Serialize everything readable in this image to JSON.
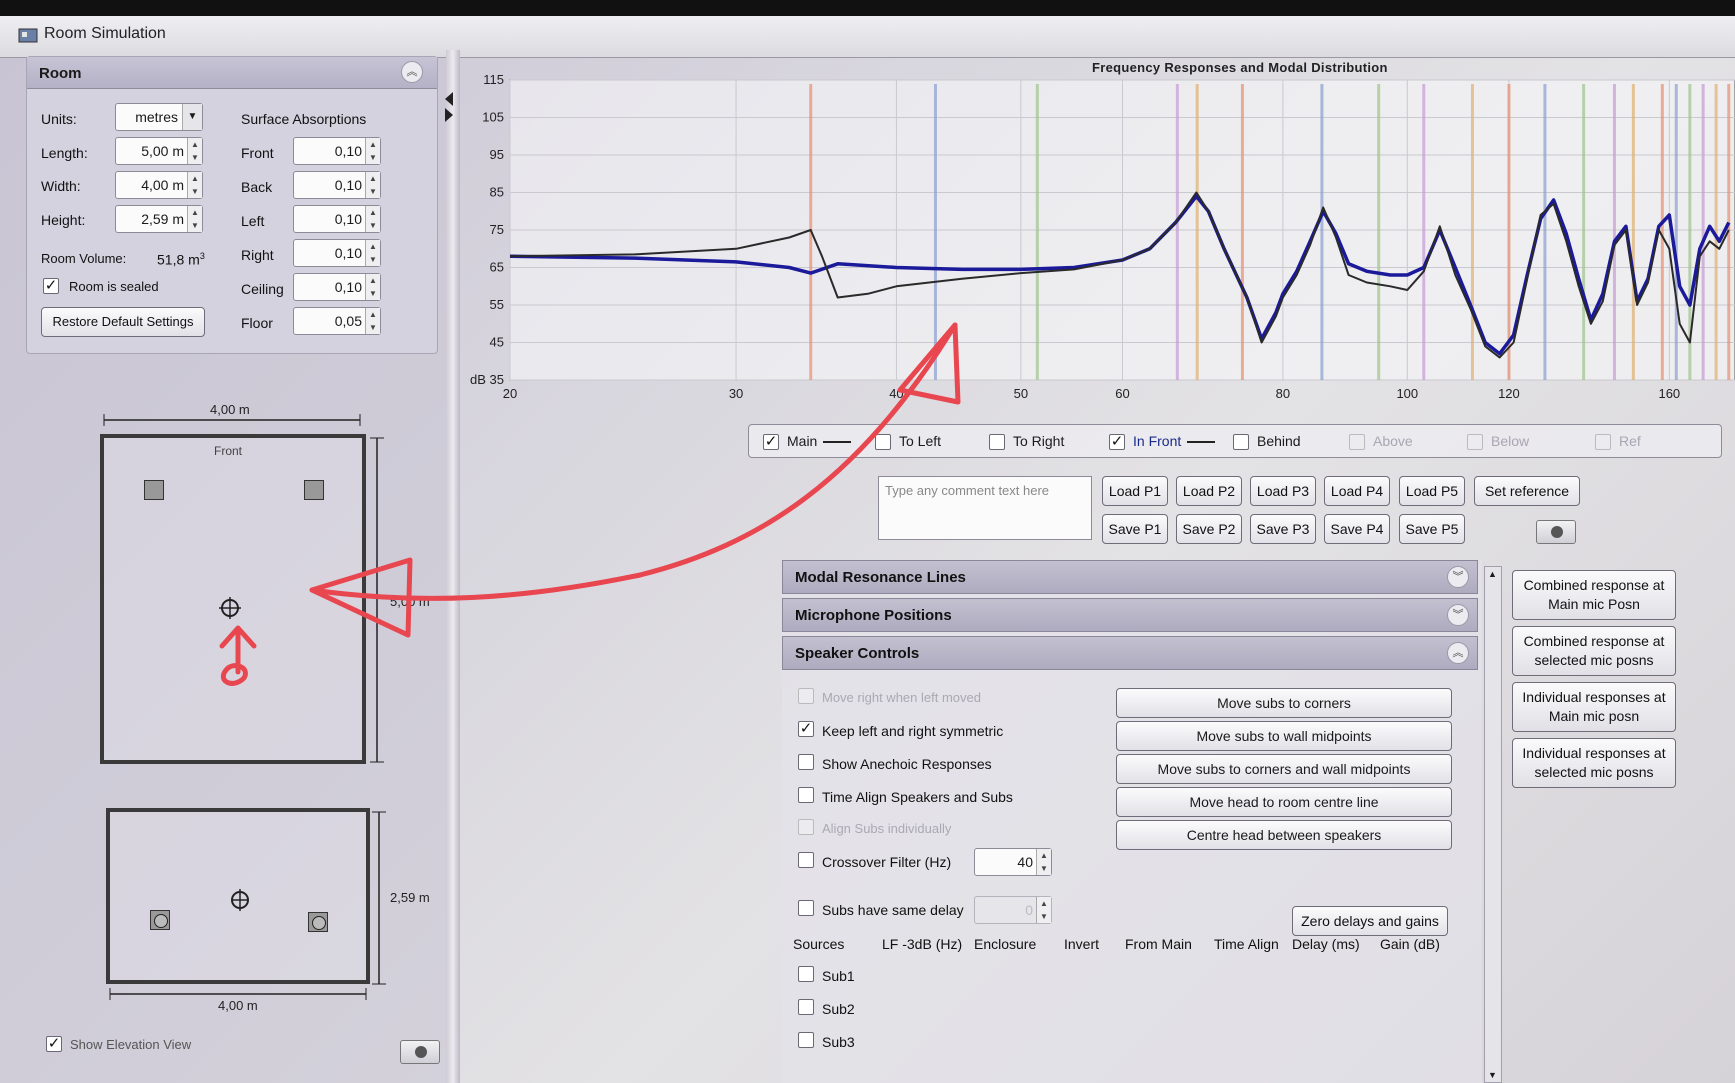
{
  "window": {
    "title": "Room Simulation"
  },
  "room_panel": {
    "title": "Room",
    "units_label": "Units:",
    "units_value": "metres",
    "length_label": "Length:",
    "length_value": "5,00 m",
    "width_label": "Width:",
    "width_value": "4,00 m",
    "height_label": "Height:",
    "height_value": "2,59 m",
    "volume_label": "Room Volume:",
    "volume_value": "51,8 m",
    "volume_unit_sup": "3",
    "sealed_label": "Room is sealed",
    "sealed_checked": true,
    "restore_button": "Restore Default Settings",
    "absorption_title": "Surface Absorptions",
    "surfaces": [
      {
        "label": "Front",
        "value": "0,10"
      },
      {
        "label": "Back",
        "value": "0,10"
      },
      {
        "label": "Left",
        "value": "0,10"
      },
      {
        "label": "Right",
        "value": "0,10"
      },
      {
        "label": "Ceiling",
        "value": "0,10"
      },
      {
        "label": "Floor",
        "value": "0,05"
      }
    ]
  },
  "plan_view": {
    "width_dim": "4,00 m",
    "front_label": "Front",
    "length_dim": "5,00 m"
  },
  "elevation_view": {
    "height_dim": "2,59 m",
    "width_dim": "4,00 m",
    "show_label": "Show Elevation View",
    "show_checked": true
  },
  "chart_data": {
    "type": "line",
    "title": "Frequency Responses and Modal Distribution",
    "ylabel": "dB",
    "ylim": [
      35,
      115
    ],
    "yticks": [
      35,
      45,
      55,
      65,
      75,
      85,
      95,
      105,
      115
    ],
    "xscale": "log",
    "xlim": [
      20,
      180
    ],
    "xticks": [
      20,
      30,
      40,
      50,
      60,
      80,
      100,
      120,
      160
    ],
    "grid": true,
    "series": [
      {
        "name": "Main",
        "color": "#1a1a9a",
        "x": [
          20,
          25,
          30,
          33,
          34.3,
          36,
          40,
          45,
          50,
          55,
          60,
          63,
          66,
          68.5,
          70,
          72,
          75,
          77,
          79,
          80,
          82,
          84,
          86,
          88,
          90,
          93,
          97,
          100,
          103,
          106,
          109,
          112,
          115,
          118,
          121,
          124,
          127,
          130,
          133,
          136,
          139,
          142,
          145,
          148,
          151,
          154,
          157,
          160,
          163,
          166,
          169,
          172,
          175,
          178
        ],
        "y": [
          68,
          67.5,
          66.5,
          65,
          63.5,
          66,
          65,
          64.5,
          64.5,
          65,
          67,
          70,
          77,
          84,
          80,
          70,
          57,
          46,
          53,
          58,
          64,
          72,
          80,
          74,
          66,
          64,
          63,
          63,
          65,
          75,
          65,
          55,
          45,
          42,
          47,
          63,
          78,
          83,
          74,
          62,
          51,
          58,
          72,
          76,
          56,
          62,
          76,
          79,
          60,
          55,
          70,
          76,
          72,
          77
        ]
      },
      {
        "name": "In Front",
        "color": "#2a2a2a",
        "x": [
          20,
          25,
          30,
          33,
          34.3,
          35,
          36,
          38,
          40,
          45,
          50,
          55,
          60,
          63,
          66,
          68.5,
          70,
          72,
          75,
          77,
          79,
          80,
          82,
          84,
          86,
          88,
          90,
          93,
          97,
          100,
          103,
          106,
          109,
          112,
          115,
          118,
          121,
          124,
          127,
          130,
          133,
          136,
          139,
          142,
          145,
          148,
          151,
          154,
          157,
          160,
          163,
          166,
          169,
          172,
          175,
          178
        ],
        "y": [
          68,
          68.5,
          70,
          73,
          75,
          68,
          57,
          58,
          60,
          62,
          63.5,
          64.5,
          67,
          70,
          77,
          85,
          80,
          70,
          57,
          45,
          52,
          57,
          63,
          71,
          81,
          73,
          63,
          61,
          60,
          59,
          64,
          76,
          63,
          54,
          44,
          41,
          45,
          62,
          79,
          82,
          72,
          60,
          50,
          56,
          71,
          75,
          55,
          61,
          75,
          70,
          50,
          45,
          68,
          72,
          70,
          75
        ]
      }
    ],
    "modal_lines": [
      34.3,
      42.9,
      51.5,
      66.2,
      68.6,
      74.4,
      85.8,
      95.0,
      103.0,
      112.4,
      120.0,
      128.0,
      137.2,
      145.0,
      150.0,
      158.0,
      162.0,
      166.0,
      170.0,
      174.0,
      178.0
    ]
  },
  "legend": {
    "items": [
      {
        "label": "Main",
        "checked": true,
        "disabled": false,
        "line": true
      },
      {
        "label": "To Left",
        "checked": false,
        "disabled": false,
        "line": false
      },
      {
        "label": "To Right",
        "checked": false,
        "disabled": false,
        "line": false
      },
      {
        "label": "In Front",
        "checked": true,
        "disabled": false,
        "line": true
      },
      {
        "label": "Behind",
        "checked": false,
        "disabled": false,
        "line": false
      },
      {
        "label": "Above",
        "checked": false,
        "disabled": true,
        "line": false
      },
      {
        "label": "Below",
        "checked": false,
        "disabled": true,
        "line": false
      },
      {
        "label": "Ref",
        "checked": false,
        "disabled": true,
        "line": false
      }
    ]
  },
  "presets": {
    "comment_placeholder": "Type any comment text here",
    "load_buttons": [
      "Load P1",
      "Load P2",
      "Load P3",
      "Load P4",
      "Load P5"
    ],
    "save_buttons": [
      "Save P1",
      "Save P2",
      "Save P3",
      "Save P4",
      "Save P5"
    ],
    "set_reference": "Set reference"
  },
  "sections": {
    "modal": "Modal Resonance Lines",
    "mic": "Microphone Positions",
    "speaker": "Speaker Controls"
  },
  "speaker_controls": {
    "move_right": "Move right when left moved",
    "keep_symmetric": "Keep left and right symmetric",
    "show_anechoic": "Show Anechoic Responses",
    "time_align": "Time Align Speakers and Subs",
    "align_subs": "Align Subs individually",
    "crossover": "Crossover Filter (Hz)",
    "crossover_value": "40",
    "same_delay": "Subs have same delay",
    "same_delay_value": "0",
    "zero_delays": "Zero delays and gains",
    "actions": [
      "Move subs to corners",
      "Move subs to wall midpoints",
      "Move subs to corners and wall midpoints",
      "Move head to room centre line",
      "Centre head between speakers"
    ],
    "headers": [
      "Sources",
      "LF -3dB (Hz)",
      "Enclosure",
      "Invert",
      "From Main",
      "Time Align",
      "Delay (ms)",
      "Gain (dB)"
    ],
    "sources": [
      "Sub1",
      "Sub2",
      "Sub3"
    ]
  },
  "side_buttons": [
    {
      "line1": "Combined response at",
      "line2": "Main mic Posn"
    },
    {
      "line1": "Combined response at",
      "line2": "selected mic posns"
    },
    {
      "line1": "Individual responses at",
      "line2": "Main mic posn"
    },
    {
      "line1": "Individual responses at",
      "line2": "selected mic posns"
    }
  ],
  "colors": {
    "annotation": "#e8474f",
    "main_series": "#1a1a9a",
    "in_front_series": "#2a2a2a"
  }
}
